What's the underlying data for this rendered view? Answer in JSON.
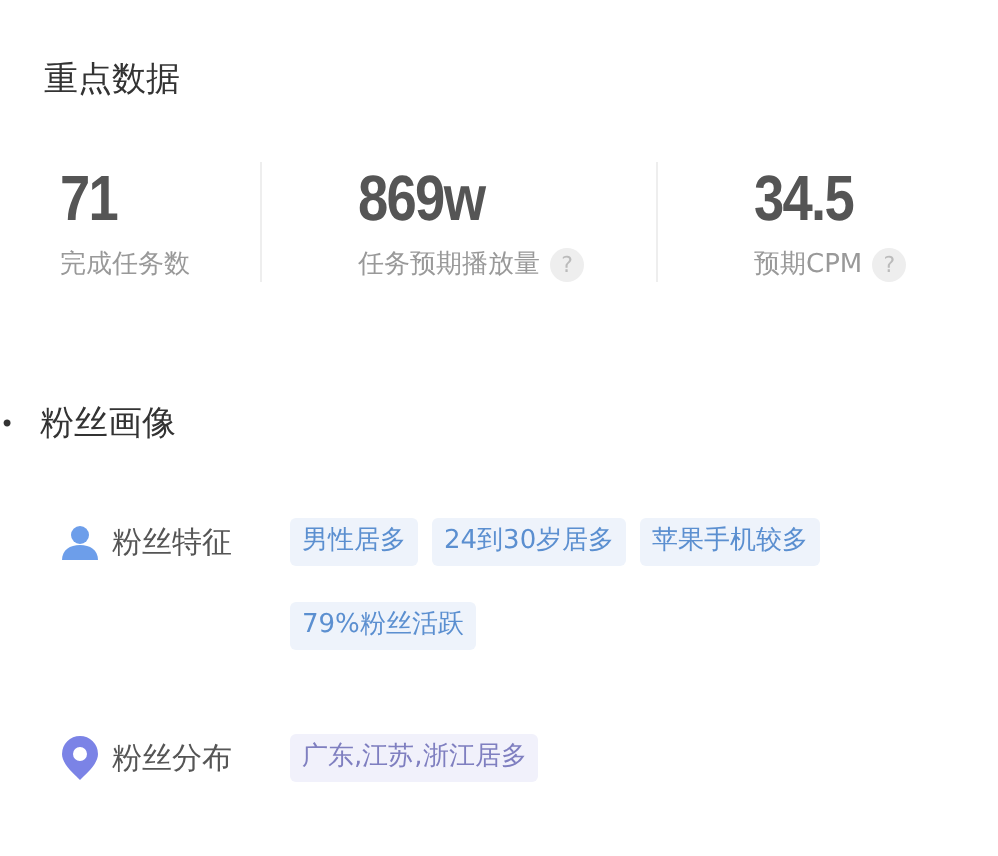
{
  "key_data": {
    "title": "重点数据",
    "stats": [
      {
        "value": "71",
        "label": "完成任务数"
      },
      {
        "value": "869w",
        "label": "任务预期播放量",
        "help": "?"
      },
      {
        "value": "34.5",
        "label": "预期CPM",
        "help": "?"
      }
    ]
  },
  "fan_profile": {
    "bullet": "•",
    "title": "粉丝画像",
    "rows": [
      {
        "kind": "person",
        "label": "粉丝特征",
        "tags": [
          "男性居多",
          "24到30岁居多",
          "苹果手机较多",
          "79%粉丝活跃"
        ]
      },
      {
        "kind": "location",
        "label": "粉丝分布",
        "tags": [
          "广东,江苏,浙江居多"
        ]
      }
    ]
  }
}
